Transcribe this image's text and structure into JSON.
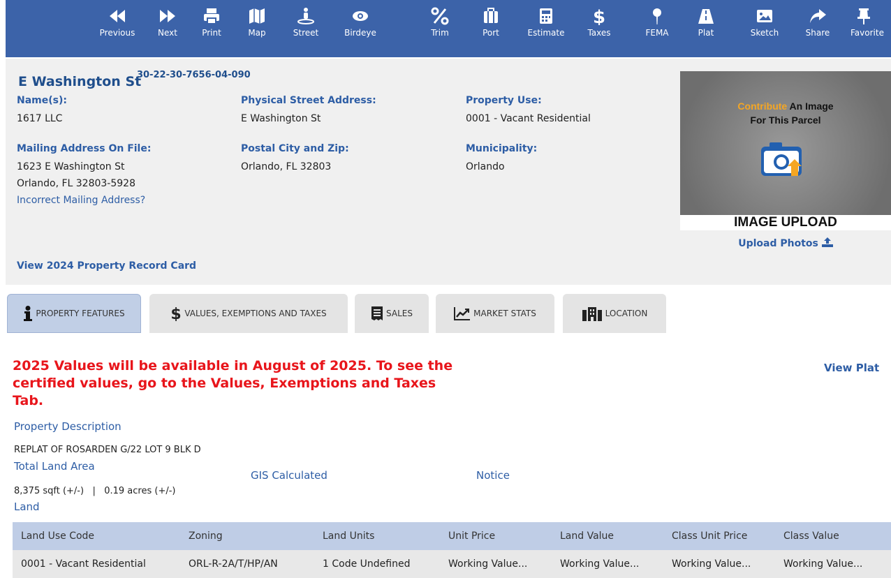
{
  "toolbar": {
    "items": [
      {
        "label": "Previous",
        "icon": "backward-icon"
      },
      {
        "label": "Next",
        "icon": "forward-icon"
      },
      {
        "label": "Print",
        "icon": "printer-icon"
      },
      {
        "label": "Map",
        "icon": "map-icon"
      },
      {
        "label": "Street",
        "icon": "street-view-icon"
      },
      {
        "label": "Birdeye",
        "icon": "eye-icon"
      },
      {
        "label": "Trim",
        "icon": "percent-icon"
      },
      {
        "label": "Port",
        "icon": "portfolio-icon"
      },
      {
        "label": "Estimate",
        "icon": "calculator-icon"
      },
      {
        "label": "Taxes",
        "icon": "dollar-icon"
      },
      {
        "label": "FEMA",
        "icon": "map-pin-icon"
      },
      {
        "label": "Plat",
        "icon": "road-icon"
      },
      {
        "label": "Sketch",
        "icon": "image-icon"
      },
      {
        "label": "Share",
        "icon": "share-icon"
      },
      {
        "label": "Favorite",
        "icon": "thumbtack-icon"
      }
    ]
  },
  "header": {
    "street": "E Washington St",
    "parcel_id": "30-22-30-7656-04-090",
    "names_label": "Name(s):",
    "names_value": "1617 LLC",
    "physical_label": "Physical Street Address:",
    "physical_value": "E Washington St",
    "use_label": "Property Use:",
    "use_value": "0001 - Vacant Residential",
    "mailing_label": "Mailing Address On File:",
    "mailing_line1": "1623 E Washington St",
    "mailing_line2": "Orlando, FL 32803-5928",
    "incorrect_link": "Incorrect Mailing Address?",
    "postal_label": "Postal City and Zip:",
    "postal_value": "Orlando, FL 32803",
    "municipality_label": "Municipality:",
    "municipality_value": "Orlando",
    "record_card_link": "View 2024 Property Record Card",
    "photo": {
      "line1_highlight": "Contribute",
      "line1_rest": " An Image",
      "line2": "For This Parcel",
      "caption": "IMAGE UPLOAD",
      "upload_link": "Upload Photos"
    }
  },
  "tabs": [
    {
      "label": "PROPERTY FEATURES",
      "icon": "info-icon",
      "active": true
    },
    {
      "label": "VALUES, EXEMPTIONS AND TAXES",
      "icon": "dollar-icon",
      "active": false
    },
    {
      "label": "SALES",
      "icon": "receipt-icon",
      "active": false
    },
    {
      "label": "MARKET STATS",
      "icon": "chart-line-icon",
      "active": false
    },
    {
      "label": "LOCATION",
      "icon": "building-icon",
      "active": false
    }
  ],
  "content": {
    "notice": "2025 Values will be available in August of 2025. To see the certified values, go to the Values, Exemptions and Taxes Tab.",
    "view_plat": "View Plat",
    "property_description_label": "Property Description",
    "property_description": "REPLAT OF ROSARDEN G/22 LOT 9 BLK D",
    "total_land_area_label": "Total Land Area",
    "total_land_area": "8,375 sqft (+/-)   |   0.19 acres (+/-)",
    "gis_calculated": "GIS Calculated",
    "notice_link": "Notice",
    "land_label": "Land"
  },
  "land_table": {
    "headers": [
      "Land Use Code",
      "Zoning",
      "Land Units",
      "Unit Price",
      "Land Value",
      "Class Unit Price",
      "Class Value"
    ],
    "rows": [
      [
        "0001 - Vacant Residential",
        "ORL-R-2A/T/HP/AN",
        "1 Code Undefined",
        "Working Value...",
        "Working Value...",
        "Working Value...",
        "Working Value..."
      ]
    ]
  },
  "colors": {
    "toolbar_bg": "#3c63a9",
    "link_blue": "#2d5da5",
    "notice_red": "#e8151b",
    "table_header": "#bfcde6",
    "active_tab": "#c1cfe6"
  }
}
